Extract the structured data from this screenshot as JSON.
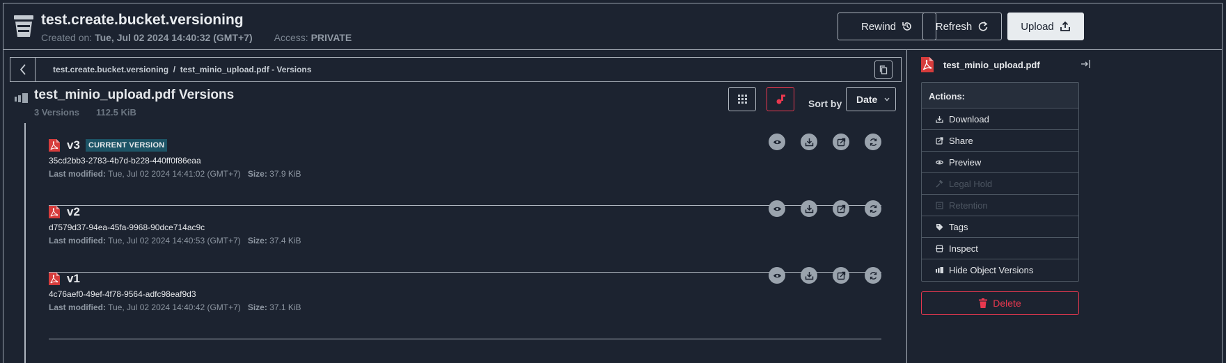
{
  "header": {
    "bucket_name": "test.create.bucket.versioning",
    "created_label": "Created on:",
    "created_value": "Tue, Jul 02 2024 14:40:32 (GMT+7)",
    "access_label": "Access:",
    "access_value": "PRIVATE",
    "rewind_label": "Rewind",
    "refresh_label": "Refresh",
    "upload_label": "Upload",
    "icons": {
      "bucket": "bucket-icon",
      "rewind": "history-icon",
      "refresh": "refresh-icon",
      "upload": "upload-icon"
    }
  },
  "breadcrumb": {
    "path": "test.create.bucket.versioning  /  test_minio_upload.pdf - Versions"
  },
  "versions_header": {
    "title": "test_minio_upload.pdf Versions",
    "count": "3 Versions",
    "size": "112.5 KiB",
    "sort_label": "Sort by",
    "sort_value": "Date"
  },
  "versions": [
    {
      "name": "v3",
      "badge": "CURRENT VERSION",
      "id": "35cd2bb3-2783-4b7d-b228-440ff0f86eaa",
      "modified_label": "Last modified:",
      "modified": "Tue, Jul 02 2024 14:41:02 (GMT+7)",
      "size_label": "Size:",
      "size": "37.9 KiB"
    },
    {
      "name": "v2",
      "badge": "",
      "id": "d7579d37-94ea-45fa-9968-90dce714ac9c",
      "modified_label": "Last modified:",
      "modified": "Tue, Jul 02 2024 14:40:53 (GMT+7)",
      "size_label": "Size:",
      "size": "37.4 KiB"
    },
    {
      "name": "v1",
      "badge": "",
      "id": "4c76aef0-49ef-4f78-9564-adfc98eaf9d3",
      "modified_label": "Last modified:",
      "modified": "Tue, Jul 02 2024 14:40:42 (GMT+7)",
      "size_label": "Size:",
      "size": "37.1 KiB"
    }
  ],
  "panel": {
    "file_name": "test_minio_upload.pdf",
    "actions_title": "Actions:",
    "actions": [
      {
        "label": "Download",
        "icon": "download-icon",
        "enabled": true
      },
      {
        "label": "Share",
        "icon": "share-icon",
        "enabled": true
      },
      {
        "label": "Preview",
        "icon": "eye-icon",
        "enabled": true
      },
      {
        "label": "Legal Hold",
        "icon": "gavel-icon",
        "enabled": false
      },
      {
        "label": "Retention",
        "icon": "retention-icon",
        "enabled": false
      },
      {
        "label": "Tags",
        "icon": "tag-icon",
        "enabled": true
      },
      {
        "label": "Inspect",
        "icon": "inspect-icon",
        "enabled": true
      },
      {
        "label": "Hide Object Versions",
        "icon": "versions-icon",
        "enabled": true
      }
    ],
    "delete_label": "Delete"
  },
  "colors": {
    "background": "#1c2330",
    "accent_red": "#e8384f",
    "badge_teal": "#1d5466"
  }
}
